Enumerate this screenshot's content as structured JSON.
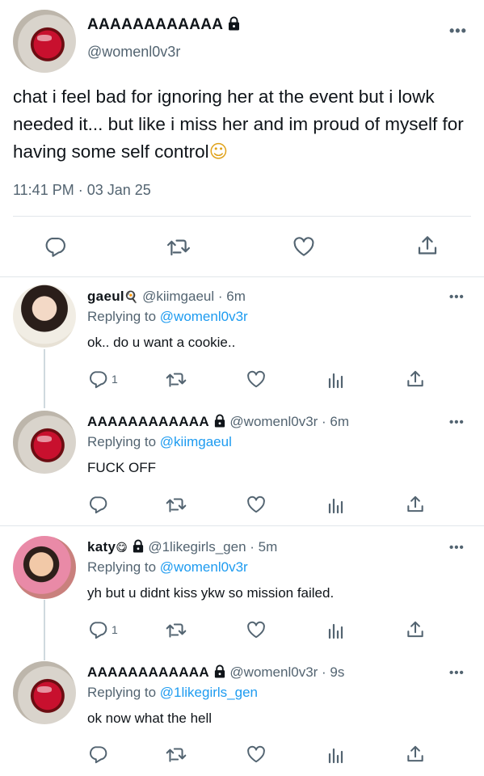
{
  "main_tweet": {
    "display_name": "AAAAAAAAAAAA",
    "handle": "@womenl0v3r",
    "text": "chat i feel bad for ignoring her at the event but i lowk needed it... but like i miss her and im proud of myself for having some self control",
    "text_emoji": "☺",
    "timestamp": "11:41 PM · 03 Jan 25",
    "more_label": "•••"
  },
  "replies": [
    {
      "display_name": "gaeul",
      "name_emoji": "🍳",
      "handle": "@kiimgaeul",
      "time": "· 6m",
      "replying_prefix": "Replying to ",
      "replying_to": "@womenl0v3r",
      "text": "ok.. do u want a cookie..",
      "reply_count": "1",
      "locked": false,
      "avatar": "girl1"
    },
    {
      "display_name": "AAAAAAAAAAAA",
      "name_emoji": "",
      "handle": "@womenl0v3r",
      "time": "· 6m",
      "replying_prefix": "Replying to ",
      "replying_to": "@kiimgaeul",
      "text": "FUCK OFF",
      "reply_count": "",
      "locked": true,
      "avatar": "spider"
    },
    {
      "display_name": "katy",
      "name_emoji": "😋",
      "handle": "@1likegirls_gen",
      "time": "· 5m",
      "replying_prefix": "Replying to ",
      "replying_to": "@womenl0v3r",
      "text": "yh but u didnt kiss ykw so mission failed.",
      "reply_count": "1",
      "locked": true,
      "avatar": "girl2"
    },
    {
      "display_name": "AAAAAAAAAAAA",
      "name_emoji": "",
      "handle": "@womenl0v3r",
      "time": "· 9s",
      "replying_prefix": "Replying to ",
      "replying_to": "@1likegirls_gen",
      "text": "ok now what the hell",
      "reply_count": "",
      "locked": true,
      "avatar": "spider"
    }
  ],
  "icons": {
    "reply": "reply-icon",
    "retweet": "retweet-icon",
    "like": "like-icon",
    "views": "views-icon",
    "share": "share-icon",
    "lock": "lock-icon",
    "more": "more-icon"
  },
  "colors": {
    "accent": "#1d9bf0",
    "secondary_text": "#536471",
    "divider": "#e1e6ea"
  }
}
